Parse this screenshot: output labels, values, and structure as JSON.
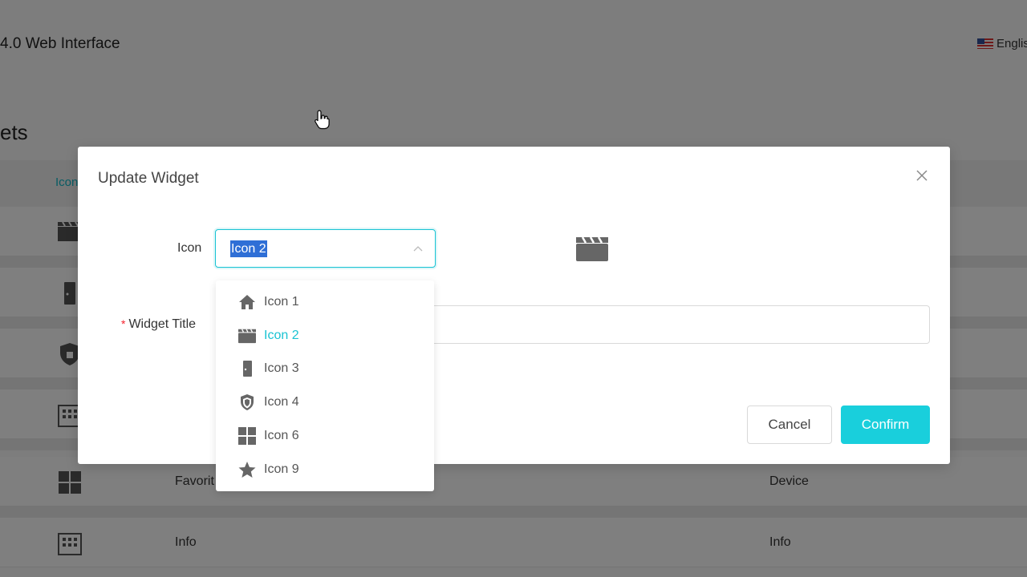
{
  "app": {
    "title": "4.0 Web Interface",
    "language": "Englis"
  },
  "page": {
    "heading": "ets",
    "column_header": "Icon",
    "rows": [
      {
        "icon": "clapperboard-icon",
        "col_a": "",
        "col_b": ""
      },
      {
        "icon": "door-icon",
        "col_a": "",
        "col_b": ""
      },
      {
        "icon": "shield-icon",
        "col_a": "",
        "col_b": ""
      },
      {
        "icon": "building-icon",
        "col_a": "",
        "col_b": ""
      },
      {
        "icon": "grid-icon",
        "col_a": "Favorit",
        "col_b": "Device"
      },
      {
        "icon": "building-icon",
        "col_a": "Info",
        "col_b": "Info"
      }
    ]
  },
  "modal": {
    "title": "Update Widget",
    "icon_label": "Icon",
    "title_label": "Widget Title",
    "required_mark": "*",
    "selected_icon": "Icon 2",
    "widget_title_value": "",
    "cancel_label": "Cancel",
    "confirm_label": "Confirm",
    "accent_color": "#19cfdc"
  },
  "dropdown": {
    "options": [
      {
        "label": "Icon 1",
        "icon": "home-icon"
      },
      {
        "label": "Icon 2",
        "icon": "clapperboard-icon",
        "selected": true
      },
      {
        "label": "Icon 3",
        "icon": "door-icon"
      },
      {
        "label": "Icon 4",
        "icon": "shield-icon"
      },
      {
        "label": "Icon 6",
        "icon": "grid-icon"
      },
      {
        "label": "Icon 9",
        "icon": "star-icon"
      }
    ]
  }
}
